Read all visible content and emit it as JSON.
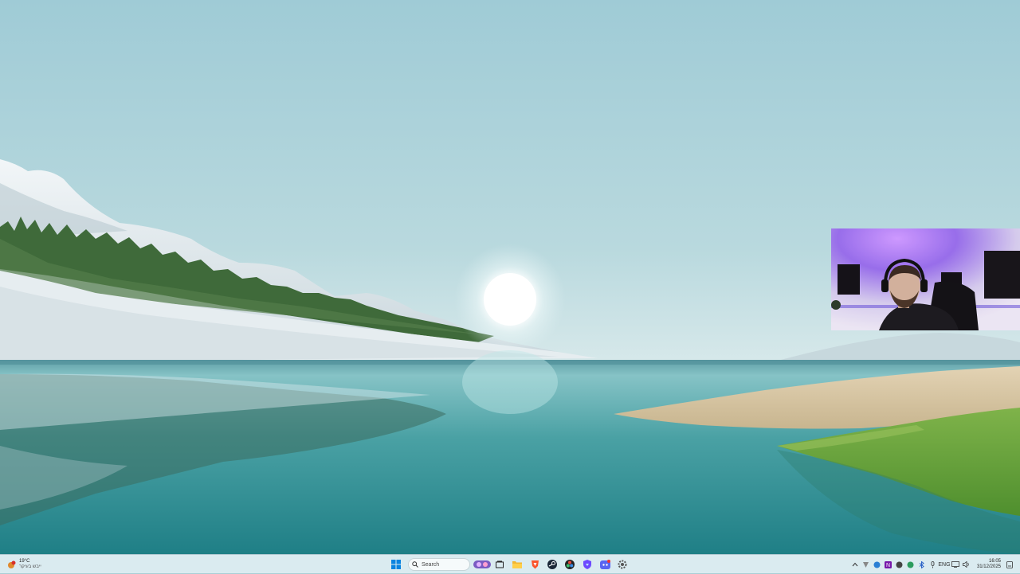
{
  "desktop": {
    "wallpaper": "Windows 11 lake landscape with snowy hills, forest, sun and grassy shore"
  },
  "webcam": {
    "label": "webcam-overlay"
  },
  "taskbar": {
    "weather": {
      "temperature": "19°C",
      "condition": "ייבש בעיקר",
      "icon": "weather-icon"
    },
    "search": {
      "placeholder": "Search"
    },
    "pinned_apps": [
      {
        "name": "start-button",
        "icon": "windows-logo-icon"
      },
      {
        "name": "copilot",
        "icon": "copilot-icon"
      },
      {
        "name": "task-view",
        "icon": "task-view-icon"
      },
      {
        "name": "file-explorer",
        "icon": "folder-icon"
      },
      {
        "name": "brave-browser",
        "icon": "brave-icon"
      },
      {
        "name": "steam",
        "icon": "steam-icon"
      },
      {
        "name": "davinci-resolve",
        "icon": "resolve-icon"
      },
      {
        "name": "proton-vpn",
        "icon": "vpn-icon"
      },
      {
        "name": "discord",
        "icon": "discord-icon"
      },
      {
        "name": "settings",
        "icon": "gear-icon"
      }
    ],
    "tray": {
      "language": "ENG",
      "time": "16:05",
      "date": "31/12/2025"
    },
    "colors": {
      "taskbar_bg": "#dcecf0",
      "accent": "#0067c0"
    }
  }
}
